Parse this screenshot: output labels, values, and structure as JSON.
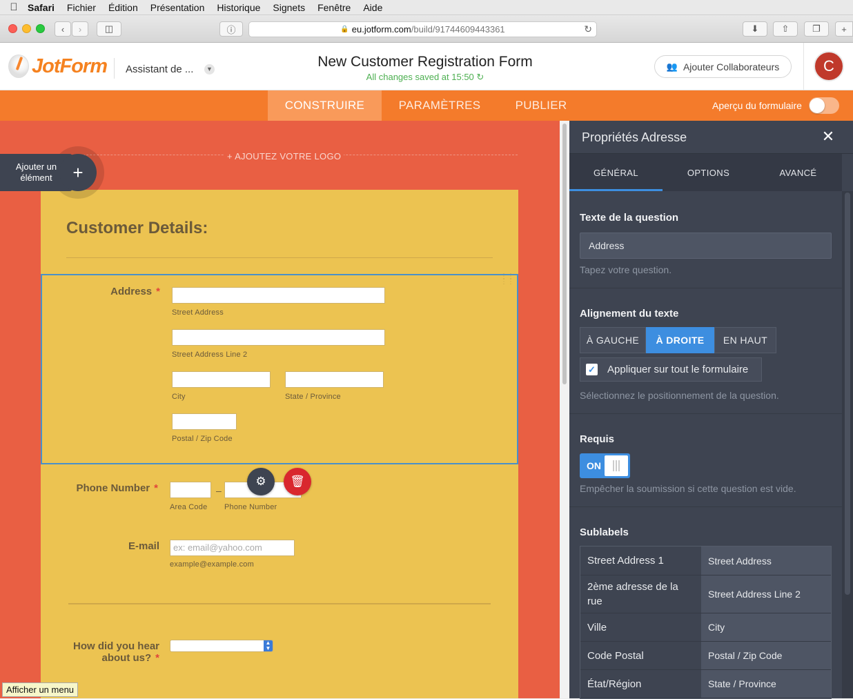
{
  "menubar": {
    "items": [
      "Safari",
      "Fichier",
      "Édition",
      "Présentation",
      "Historique",
      "Signets",
      "Fenêtre",
      "Aide"
    ]
  },
  "browser": {
    "url_domain": "eu.jotform.com",
    "url_path": "/build/91744609443361"
  },
  "header": {
    "logo_text": "JotForm",
    "assistant": "Assistant de ...",
    "form_title": "New Customer Registration Form",
    "save_status": "All changes saved at 15:50",
    "collab_label": "Ajouter Collaborateurs",
    "avatar_initial": "C"
  },
  "nav": {
    "tabs": [
      "CONSTRUIRE",
      "PARAMÈTRES",
      "PUBLIER"
    ],
    "active_tab": "CONSTRUIRE",
    "preview_label": "Aperçu du formulaire",
    "preview_on": false
  },
  "canvas": {
    "add_logo": "+ AJOUTEZ VOTRE LOGO",
    "add_element": "Ajouter un élément",
    "add_element_line1": "Ajouter un",
    "add_element_line2": "élément",
    "form": {
      "heading": "Customer Details:",
      "address": {
        "label": "Address",
        "required_mark": "*",
        "sublabels": [
          "Street Address",
          "Street Address Line 2",
          "City",
          "State / Province",
          "Postal / Zip Code"
        ]
      },
      "phone": {
        "label": "Phone Number",
        "required_mark": "*",
        "separator": "–",
        "sublabels": [
          "Area Code",
          "Phone Number"
        ]
      },
      "email": {
        "label": "E-mail",
        "placeholder": "ex: email@yahoo.com",
        "sublabel": "example@example.com"
      },
      "hear": {
        "label_line1": "How did you hear",
        "label_line2": "about us?",
        "required_mark": "*"
      }
    },
    "menu_tooltip": "Afficher un menu"
  },
  "panel": {
    "title": "Propriétés Adresse",
    "tabs": [
      "GÉNÉRAL",
      "OPTIONS",
      "AVANCÉ"
    ],
    "active_tab": "GÉNÉRAL",
    "question": {
      "title": "Texte de la question",
      "value": "Address",
      "hint": "Tapez votre question."
    },
    "alignment": {
      "title": "Alignement du texte",
      "options": [
        "À GAUCHE",
        "À DROITE",
        "EN HAUT"
      ],
      "selected": "À DROITE",
      "apply_all": "Appliquer sur tout le formulaire",
      "apply_all_checked": true,
      "hint": "Sélectionnez le positionnement de la question."
    },
    "required": {
      "title": "Requis",
      "toggle_label": "ON",
      "hint": "Empêcher la soumission si cette question est vide."
    },
    "sublabels": {
      "title": "Sublabels",
      "rows": [
        {
          "key": "Street Address 1",
          "value": "Street Address"
        },
        {
          "key": "2ème adresse de la rue",
          "value": "Street Address Line 2"
        },
        {
          "key": "Ville",
          "value": "City"
        },
        {
          "key": "Code Postal",
          "value": "Postal / Zip Code"
        },
        {
          "key": "État/Région",
          "value": "State / Province"
        }
      ]
    }
  },
  "colors": {
    "orange": "#f47b2b",
    "canvas": "#e95f43",
    "form_bg": "#ecc351",
    "panel_bg": "#3e4451",
    "accent_blue": "#3d8ee0",
    "save_green": "#4caf50"
  }
}
